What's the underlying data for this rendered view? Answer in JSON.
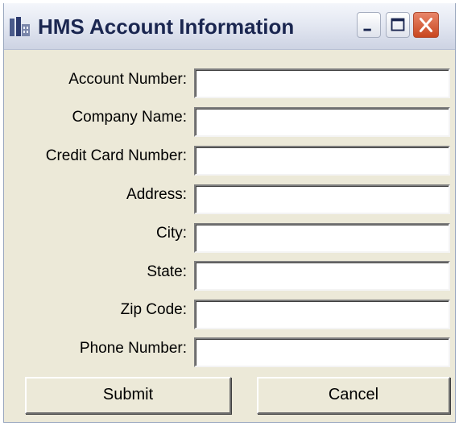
{
  "window": {
    "title": "HMS Account Information"
  },
  "form": {
    "account_number_label": "Account Number:",
    "company_name_label": "Company Name:",
    "credit_card_label": "Credit Card Number:",
    "address_label": "Address:",
    "city_label": "City:",
    "state_label": "State:",
    "zip_code_label": "Zip Code:",
    "phone_number_label": "Phone Number:",
    "account_number_value": "",
    "company_name_value": "",
    "credit_card_value": "",
    "address_value": "",
    "city_value": "",
    "state_value": "",
    "zip_code_value": "",
    "phone_number_value": ""
  },
  "buttons": {
    "submit_label": "Submit",
    "cancel_label": "Cancel"
  },
  "colors": {
    "window_bg": "#ece9d8",
    "title_text": "#1a2650",
    "close_button": "#c8461f"
  },
  "icons": {
    "app": "app-icon",
    "minimize": "minimize-icon",
    "maximize": "maximize-icon",
    "close": "close-icon"
  }
}
